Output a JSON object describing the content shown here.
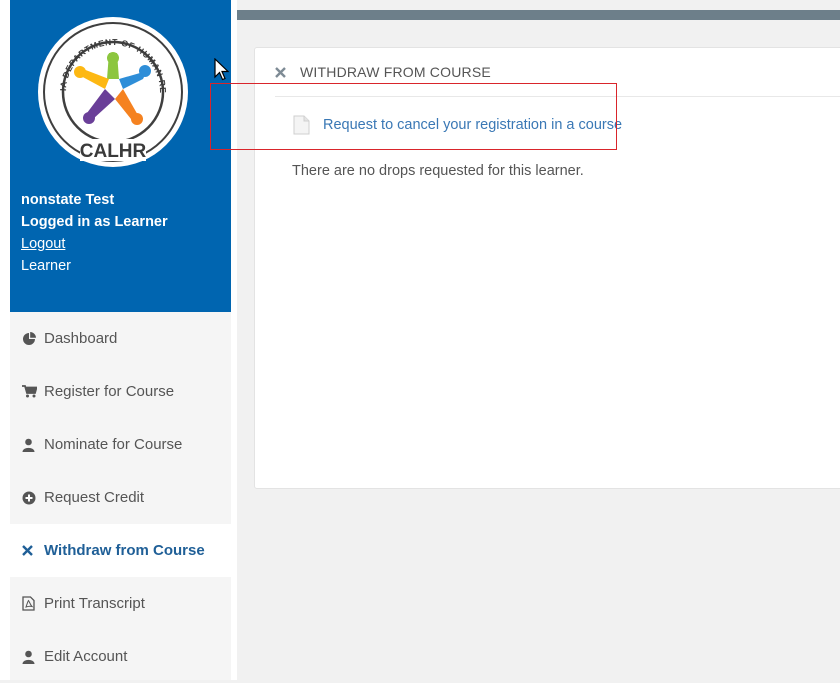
{
  "profile": {
    "user_name": "nonstate Test",
    "login_status": "Logged in as Learner",
    "logout_label": "Logout",
    "role": "Learner",
    "logo_text": "CALIFORNIA DEPARTMENT OF HUMAN RESOURCES",
    "logo_abbrev": "CALHR"
  },
  "nav": {
    "items": [
      {
        "label": "Dashboard",
        "icon": "pie-chart-icon"
      },
      {
        "label": "Register for Course",
        "icon": "cart-icon"
      },
      {
        "label": "Nominate for Course",
        "icon": "user-icon"
      },
      {
        "label": "Request Credit",
        "icon": "plus-circle-icon"
      },
      {
        "label": "Withdraw from Course",
        "icon": "close-icon",
        "active": true
      },
      {
        "label": "Print Transcript",
        "icon": "pdf-file-icon"
      },
      {
        "label": "Edit Account",
        "icon": "user-icon"
      }
    ]
  },
  "panel": {
    "title": "WITHDRAW FROM COURSE",
    "request_link": "Request to cancel your registration in a course",
    "empty_message": "There are no drops requested for this learner."
  },
  "colors": {
    "profile_bg": "#0065b0",
    "active_text": "#1f5f97",
    "link": "#3a78b5",
    "highlight": "#d9252b",
    "topbar": "#6d7f8a"
  }
}
